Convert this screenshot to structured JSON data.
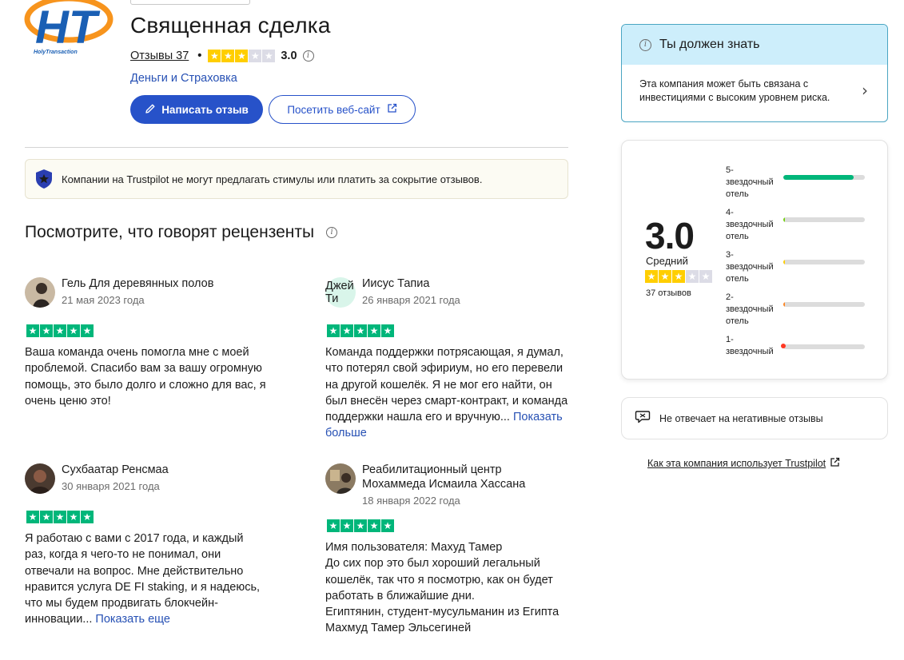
{
  "company": {
    "logo_text": "HT",
    "logo_caption": "HolyTransaction",
    "name": "Священная сделка",
    "reviews_link": "Отзывы 37",
    "score": "3.0",
    "star_rating": 3,
    "category": "Деньги и Страховка",
    "write_review_label": "Написать отзыв",
    "visit_site_label": "Посетить веб-сайт"
  },
  "notice": {
    "text_prefix": "Компании на ",
    "brand": "Trustpilot",
    "text_suffix": " не могут предлагать стимулы или платить за сокрытие отзывов."
  },
  "section_title": "Посмотрите, что говорят рецензенты",
  "reviews": [
    {
      "name": "Гель Для деревянных полов",
      "date": "21 мая 2023 года",
      "stars": 5,
      "text": "Ваша команда очень помогла мне с моей проблемой. Спасибо вам за вашу огромную помощь, это было долго и сложно для вас, я очень ценю это!",
      "more": ""
    },
    {
      "name": "Иисус Тапиа",
      "avatar_initials": "Джей Ти",
      "date": "26 января 2021 года",
      "stars": 5,
      "text": "Команда поддержки потрясающая, я думал, что потерял свой эфириум, но его перевели на другой кошелёк. Я не мог его найти, он был внесён через смарт-контракт, и команда поддержки нашла его и вручную...",
      "more": "Показать больше"
    },
    {
      "name": "Сухбаатар Ренсмаа",
      "date": "30 января 2021 года",
      "stars": 5,
      "text": "Я работаю с вами с 2017 года, и каждый раз, когда я чего-то не понимал, они отвечали на вопрос. Мне действительно нравится услуга DE FI staking, и я надеюсь, что мы будем продвигать блокчейн-инновации...",
      "more": "Показать еще"
    },
    {
      "name": "Реабилитационный центр Мохаммеда Исмаила Хассана",
      "date": "18 января 2022 года",
      "stars": 5,
      "text": "Имя пользователя: Махуд Тамер\nДо сих пор это был хороший легальный кошелёк, так что я посмотрю, как он будет работать в ближайшие дни.\nЕгиптянин, студент-мусульманин из Египта Махмуд Тамер Эльсегиней",
      "more": ""
    }
  ],
  "know": {
    "title": "Ты должен знать",
    "text": "Эта компания может быть связана с инвестициями с высоким уровнем риска."
  },
  "rating_summary": {
    "score": "3.0",
    "label": "Средний",
    "stars": 3,
    "count": "37 отзывов",
    "distribution": [
      {
        "label": "5-\nзвездочный\nотель",
        "fraction": 0.86,
        "color": "#00b67a"
      },
      {
        "label": "4-\nзвездочный\nотель",
        "fraction": 0.02,
        "color": "#73cf11"
      },
      {
        "label": "3-\nзвездочный\nотель",
        "fraction": 0.02,
        "color": "#ffce00"
      },
      {
        "label": "2-\nзвездочный\nотель",
        "fraction": 0.02,
        "color": "#ff8622"
      },
      {
        "label": "1-\nзвездочный",
        "fraction": 0.0,
        "color": "#ff3722"
      }
    ]
  },
  "no_reply_text": "Не отвечает на негативные отзывы",
  "how_uses": {
    "prefix": "Как эта компания использует ",
    "brand": "Trustpilot"
  },
  "colors": {
    "accent_blue": "#2752c9",
    "trustpilot_green": "#00b67a",
    "star_yellow": "#ffce00",
    "info_bg": "#cdeefb"
  }
}
